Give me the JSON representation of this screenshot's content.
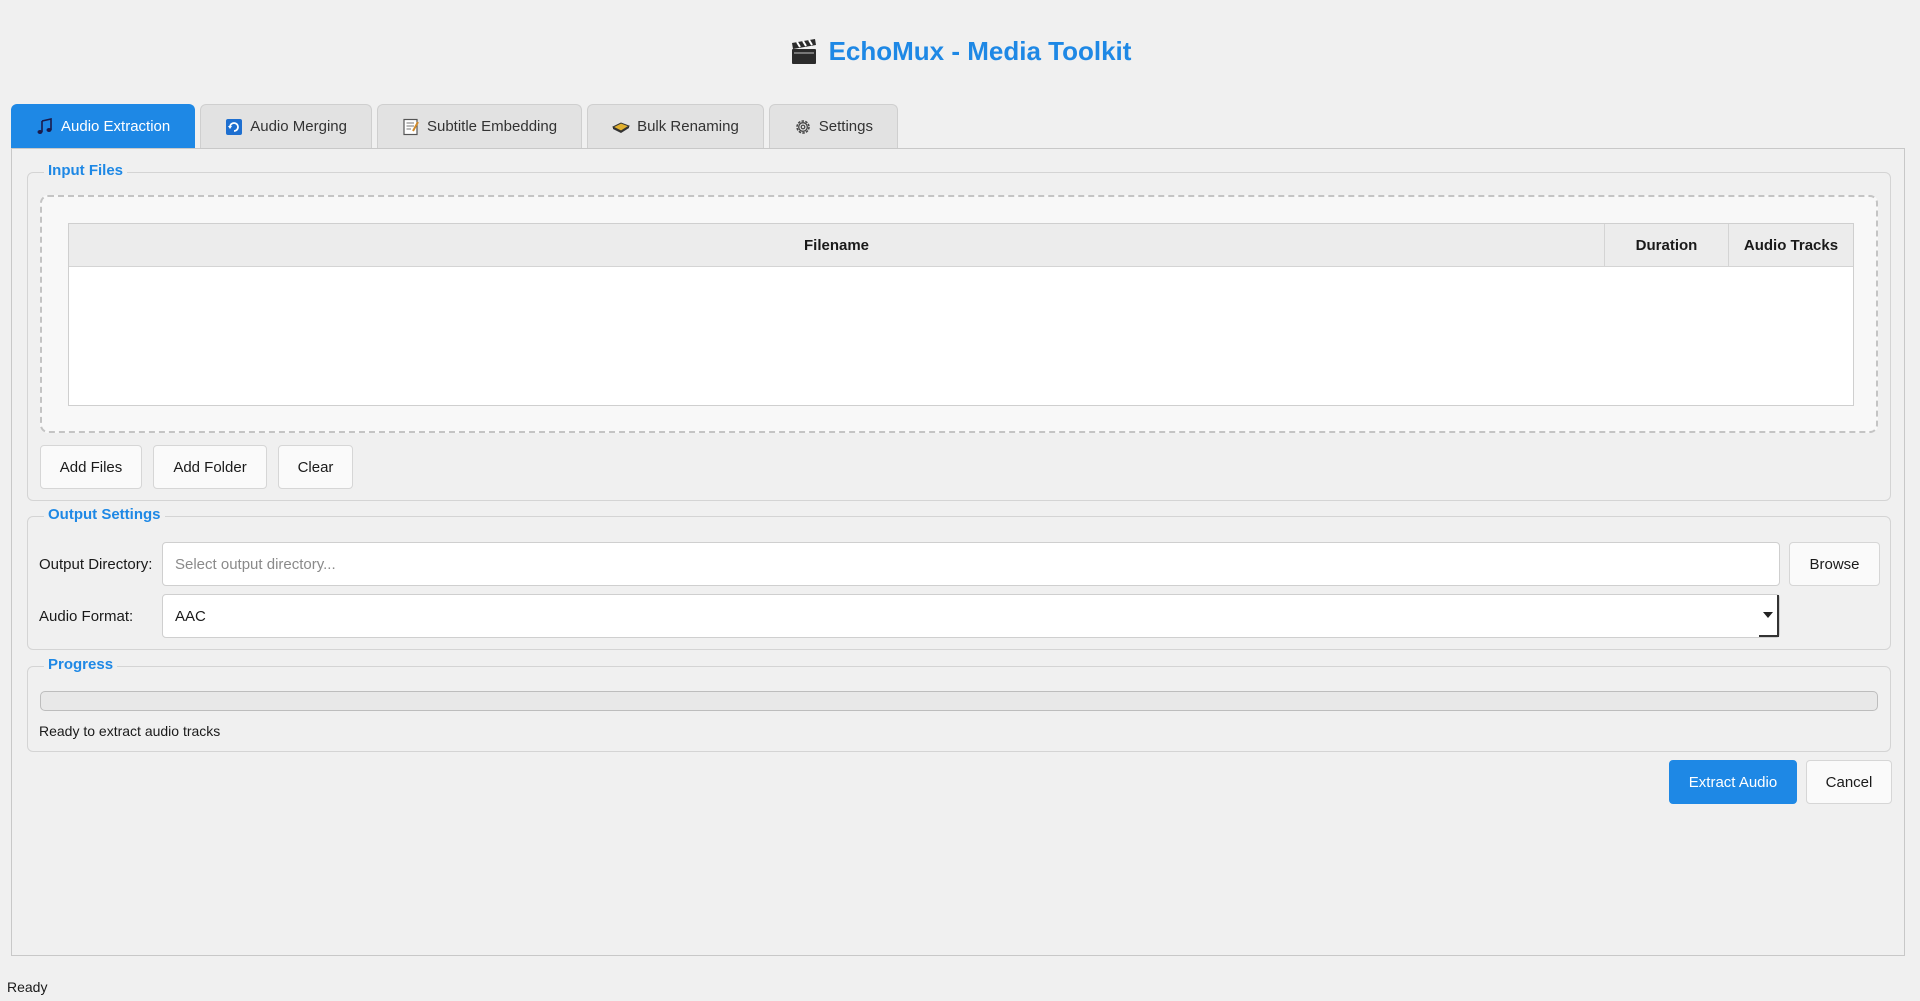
{
  "app": {
    "title": "EchoMux - Media Toolkit"
  },
  "tabs": [
    {
      "label": "Audio Extraction",
      "icon": "music-note-icon",
      "active": true
    },
    {
      "label": "Audio Merging",
      "icon": "refresh-icon",
      "active": false
    },
    {
      "label": "Subtitle Embedding",
      "icon": "memo-icon",
      "active": false
    },
    {
      "label": "Bulk Renaming",
      "icon": "folder-icon",
      "active": false
    },
    {
      "label": "Settings",
      "icon": "gear-icon",
      "active": false
    }
  ],
  "input_files": {
    "title": "Input Files",
    "columns": [
      "Filename",
      "Duration",
      "Audio Tracks"
    ],
    "rows": [],
    "buttons": {
      "add_files": "Add Files",
      "add_folder": "Add Folder",
      "clear": "Clear"
    }
  },
  "output_settings": {
    "title": "Output Settings",
    "directory_label": "Output Directory:",
    "directory_placeholder": "Select output directory...",
    "directory_value": "",
    "browse": "Browse",
    "format_label": "Audio Format:",
    "format_value": "AAC"
  },
  "progress": {
    "title": "Progress",
    "value": 0,
    "status": "Ready to extract audio tracks"
  },
  "actions": {
    "extract": "Extract Audio",
    "cancel": "Cancel"
  },
  "statusbar": {
    "text": "Ready"
  },
  "colors": {
    "accent": "#1e88e5",
    "background": "#f0f0f0"
  }
}
